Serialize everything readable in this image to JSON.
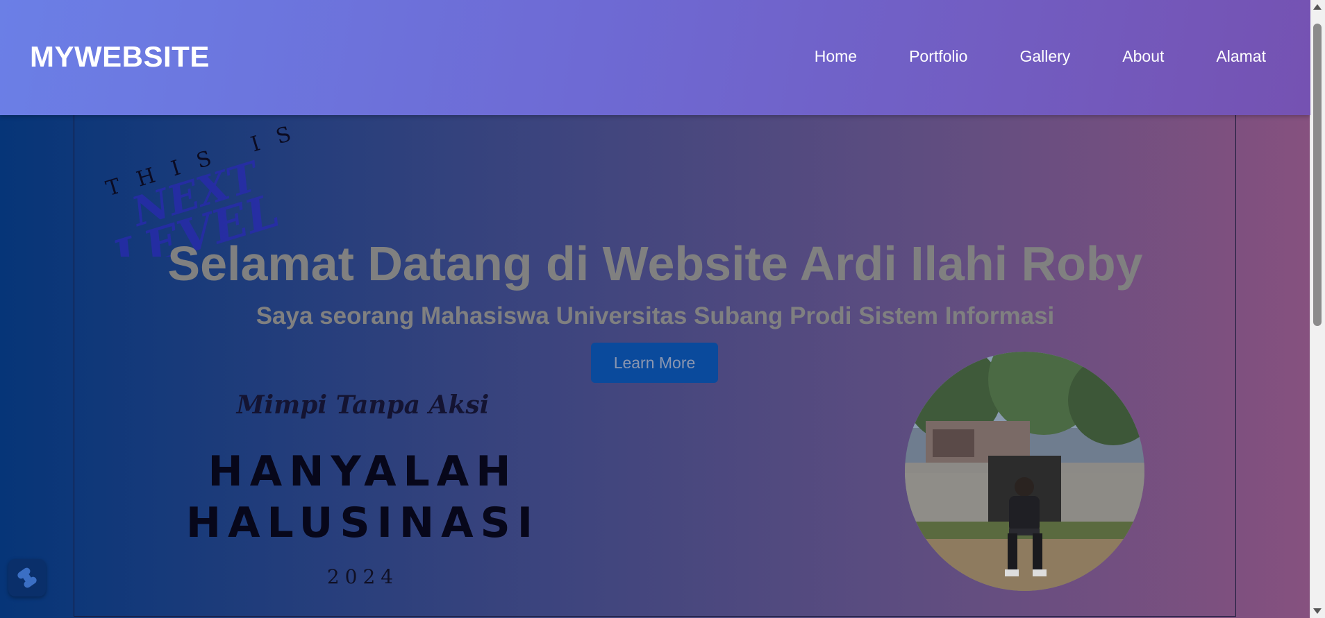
{
  "navbar": {
    "brand": "MYWEBSITE",
    "links": [
      "Home",
      "Portfolio",
      "Gallery",
      "About",
      "Alamat"
    ]
  },
  "hero": {
    "title": "Selamat Datang di Website Ardi Ilahi Roby",
    "subtitle": "Saya seorang Mahasiswa Universitas Subang Prodi Sistem Informasi",
    "button_label": "Learn More"
  },
  "decoration": {
    "line1": "THIS IS",
    "line2": "NEXT",
    "line3": "LEVEL"
  },
  "quote": {
    "line1": "Mimpi Tanpa Aksi",
    "line2": "HANYALAH",
    "line3": "HALUSINASI",
    "year": "2024"
  },
  "colors": {
    "navbar_start": "#6b7fe6",
    "navbar_end": "#7552b2",
    "hero_start": "#063578",
    "hero_end": "#86517f",
    "button": "#0a4a9c"
  },
  "icons": {
    "widget": "bolt-icon"
  }
}
